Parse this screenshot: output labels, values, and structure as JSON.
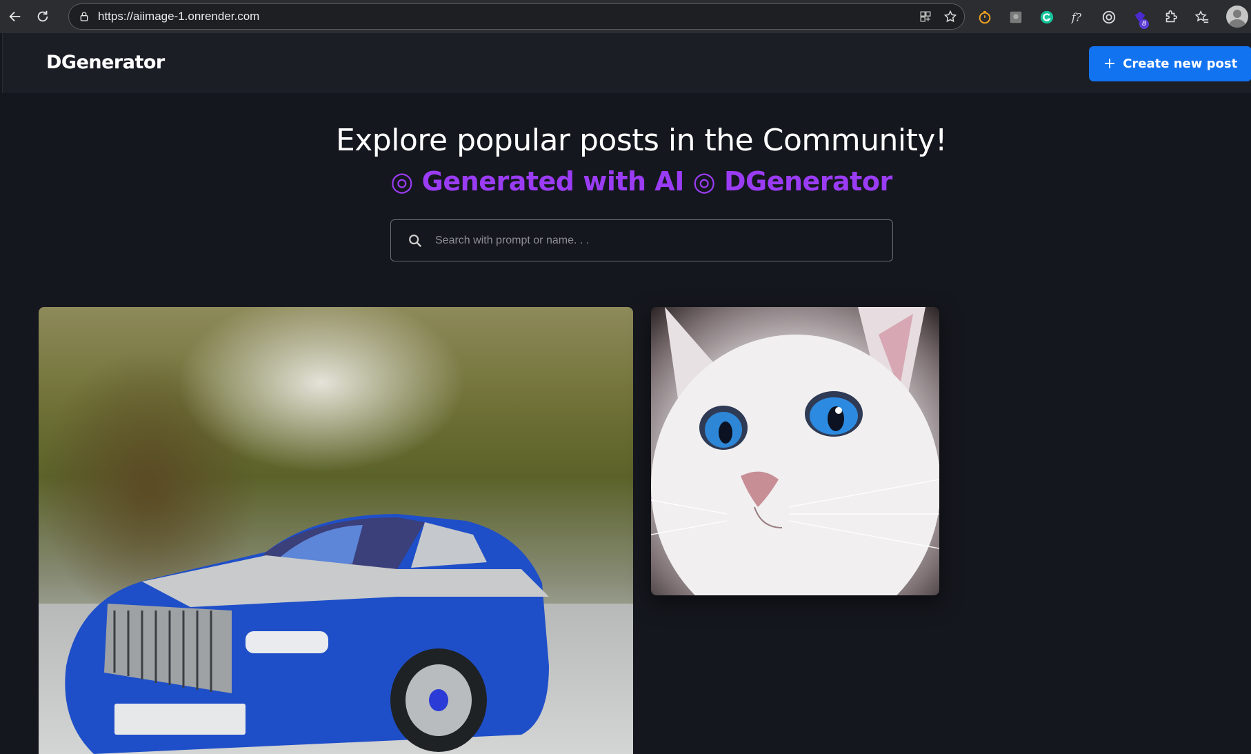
{
  "browser": {
    "url": "https://aiimage-1.onrender.com",
    "extension_badge": "8"
  },
  "header": {
    "logo": "DGenerator",
    "create_button": "Create new post",
    "create_icon": "+"
  },
  "hero": {
    "title": "Explore popular posts in the Community!",
    "subtitle": "◎ Generated with AI ◎ DGenerator"
  },
  "search": {
    "placeholder": "Search with prompt or name. . ."
  },
  "posts": [
    {
      "image": "blue-silver-luxury-car"
    },
    {
      "image": "white-cat-blue-eyes"
    }
  ],
  "colors": {
    "accent": "#1273f1",
    "subtitle": "#9b3cf5",
    "background": "#15171e",
    "header": "#1c1e26"
  }
}
